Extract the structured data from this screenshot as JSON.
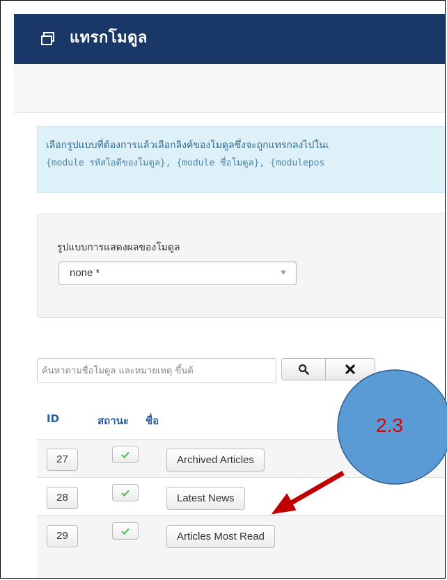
{
  "header": {
    "title": "แทรกโมดูล",
    "icon": "window-icon"
  },
  "info": {
    "line1": "เลือกรูปแบบที่ต้องการแล้วเลือกลิงค์ของโมดูลซึ่งจะถูกแทรกลงไปในเ",
    "line2": "{module รหัสไอดีของโมดูล}, {module ชื่อโมดูล}, {modulepos"
  },
  "style_panel": {
    "label": "รูปแบบการแสดงผลของโมดูล",
    "selected": "none *"
  },
  "search": {
    "placeholder": "ค้นหาตามชื่อโมดูล และหมายเหตุ ขึ้นต้"
  },
  "table": {
    "headers": {
      "id": "ID",
      "status": "สถานะ",
      "name": "ชื่อ"
    },
    "rows": [
      {
        "id": "27",
        "name": "Archived Articles"
      },
      {
        "id": "28",
        "name": "Latest News"
      },
      {
        "id": "29",
        "name": "Articles Most Read"
      }
    ]
  },
  "annotation": {
    "label": "2.3",
    "circle_color": "#5b9bd5",
    "arrow_color": "#c00000"
  },
  "colors": {
    "header_bg": "#1a3867",
    "info_bg": "#def0f8",
    "link_blue": "#2a5d9c",
    "check_green": "#5cb85c"
  }
}
